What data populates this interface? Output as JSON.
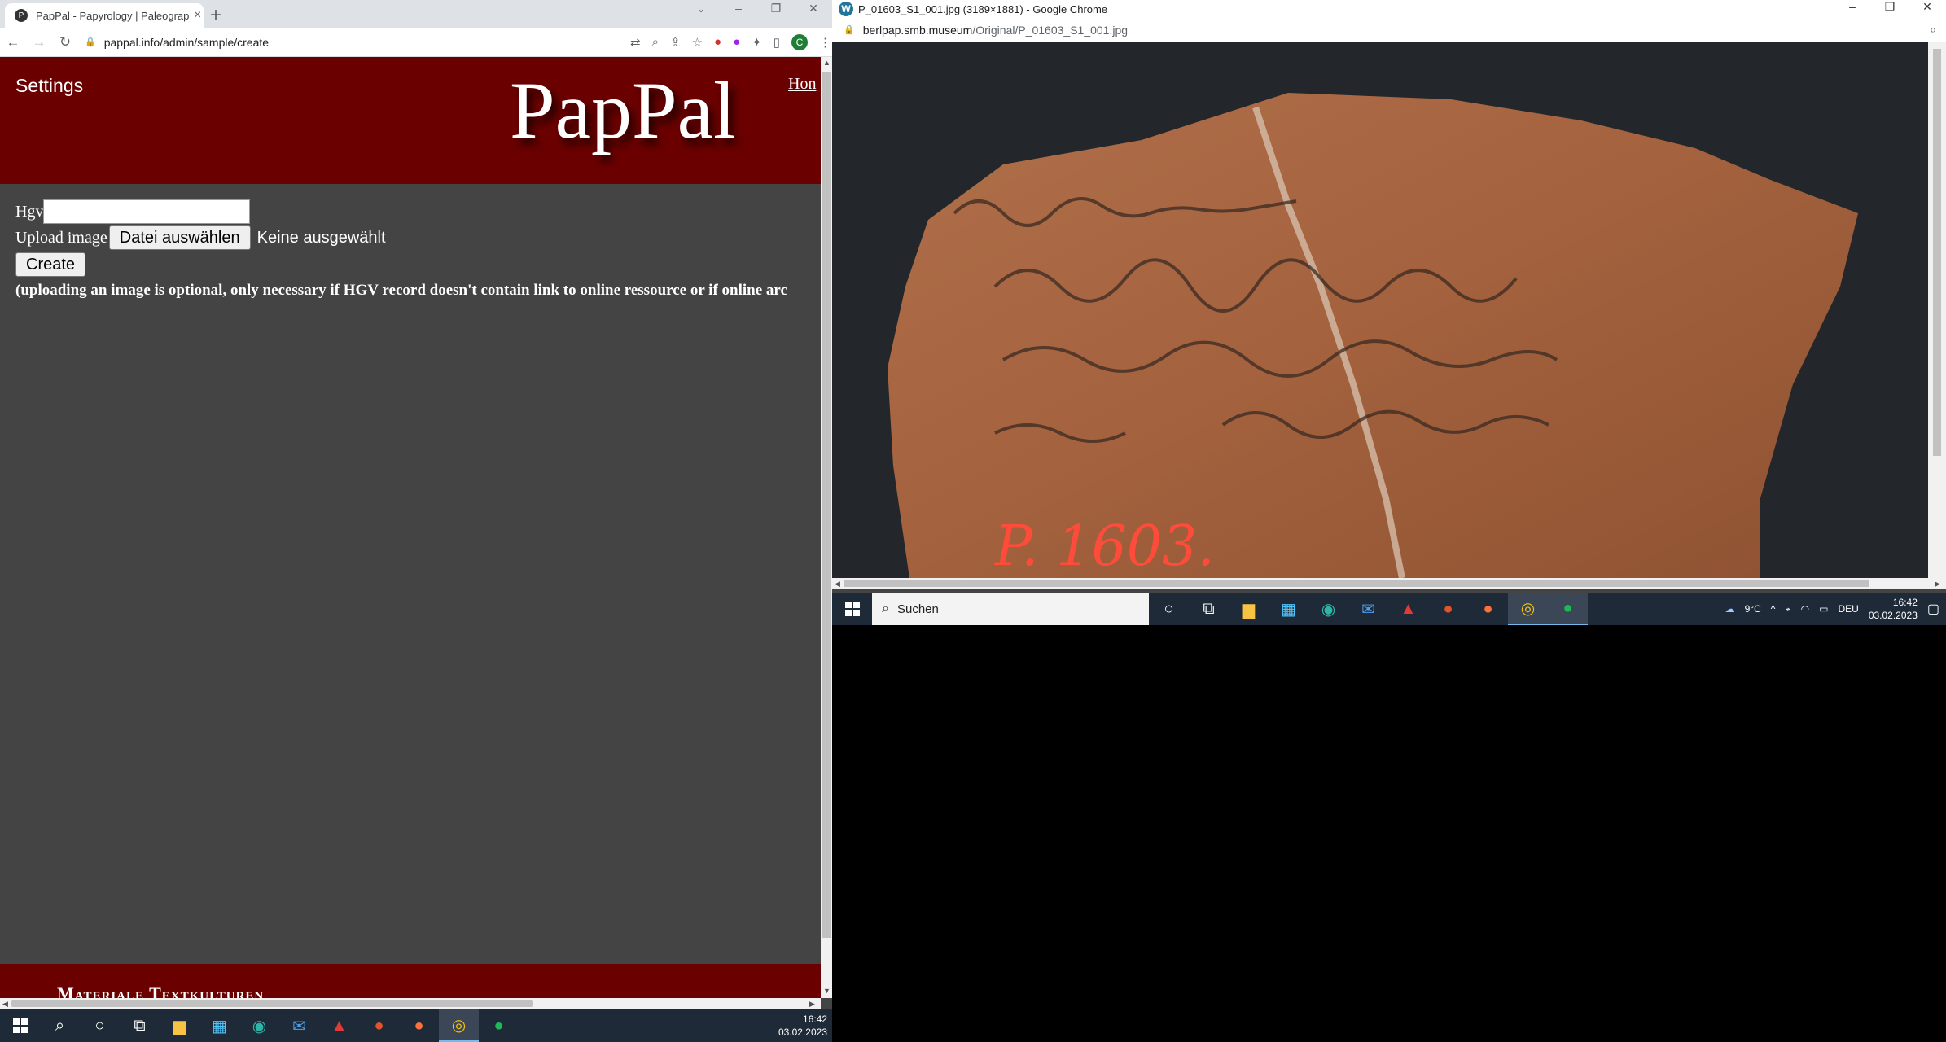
{
  "left_browser": {
    "tab_title": "PapPal - Papyrology | Paleograph",
    "url": "pappal.info/admin/sample/create",
    "profile_initial": "C",
    "page": {
      "settings_link": "Settings",
      "logo": "PapPal",
      "home_link": "Hon",
      "hgv_label": "Hgv",
      "hgv_value": "",
      "upload_label": "Upload image",
      "file_button": "Datei auswählen",
      "file_status": "Keine ausgewählt",
      "create_button": "Create",
      "note": "(uploading an image is optional, only necessary if HGV record doesn't contain link to online ressource or if online arc",
      "footer_title": "Materiale Textkulturen"
    }
  },
  "right_browser": {
    "window_title": "P_01603_S1_001.jpg (3189×1881) - Google Chrome",
    "url_domain": "berlpap.smb.museum",
    "url_path": "/Original/P_01603_S1_001.jpg",
    "image_label": "P. 1603."
  },
  "taskbar_left": {
    "time": "16:42",
    "date": "03.02.2023"
  },
  "taskbar_right": {
    "search_placeholder": "Suchen",
    "weather": "9°C",
    "language": "DEU",
    "time": "16:42",
    "date": "03.02.2023"
  },
  "colors": {
    "banner": "#6b0000",
    "page_bg": "#444444",
    "taskbar": "#1f2a38"
  }
}
